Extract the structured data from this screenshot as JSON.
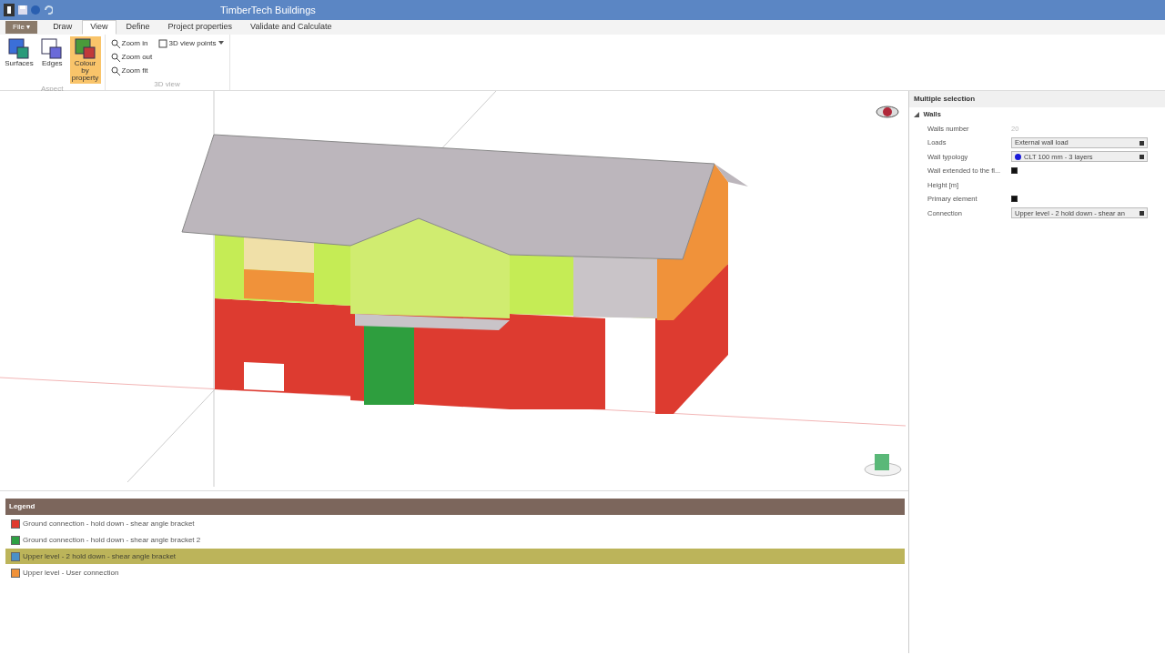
{
  "window": {
    "title": "TimberTech Buildings"
  },
  "file_button": "File ▾",
  "tabs": [
    {
      "label": "Draw",
      "selected": false
    },
    {
      "label": "View",
      "selected": true
    },
    {
      "label": "Define",
      "selected": false
    },
    {
      "label": "Project properties",
      "selected": false
    },
    {
      "label": "Validate and Calculate",
      "selected": false
    }
  ],
  "ribbon_groups": [
    {
      "label": "Aspect",
      "buttons": [
        {
          "label": "Surfaces",
          "selected": false,
          "kind": "surfaces"
        },
        {
          "label": "Edges",
          "selected": false,
          "kind": "edges"
        },
        {
          "label": "Colour by property",
          "selected": true,
          "kind": "colour"
        }
      ]
    },
    {
      "label": "3D view",
      "small_buttons": [
        {
          "label": "Zoom in"
        },
        {
          "label": "Zoom out"
        },
        {
          "label": "Zoom fit"
        }
      ],
      "dropdown": "3D view points"
    }
  ],
  "legend": {
    "title": "Legend",
    "items": [
      {
        "label": "Ground connection - hold down - shear angle bracket",
        "color": "#e03a2e",
        "selected": false
      },
      {
        "label": "Ground connection - hold down - shear angle bracket 2",
        "color": "#2ea043",
        "selected": false
      },
      {
        "label": "Upper level - 2 hold down - shear angle bracket",
        "color": "#4a90c8",
        "selected": true
      },
      {
        "label": "Upper level - User connection",
        "color": "#f0923a",
        "selected": false
      }
    ]
  },
  "properties": {
    "title": "Multiple selection",
    "section": {
      "label": "Walls",
      "expanded": true
    },
    "rows": [
      {
        "label": "Walls number",
        "kind": "text",
        "value": "20",
        "disabled": true
      },
      {
        "label": "Loads",
        "kind": "dropdown",
        "value": "External wall load"
      },
      {
        "label": "Wall typology",
        "kind": "dropdown",
        "value": "CLT 100 mm - 3 layers",
        "color": "#1a1ad8"
      },
      {
        "label": "Wall extended to the fl...",
        "kind": "checkbox",
        "checked": true
      },
      {
        "label": "Height [m]",
        "kind": "text",
        "value": ""
      },
      {
        "label": "Primary element",
        "kind": "checkbox",
        "checked": true
      },
      {
        "label": "Connection",
        "kind": "dropdown",
        "value": "Upper level - 2 hold down - shear an"
      }
    ]
  }
}
